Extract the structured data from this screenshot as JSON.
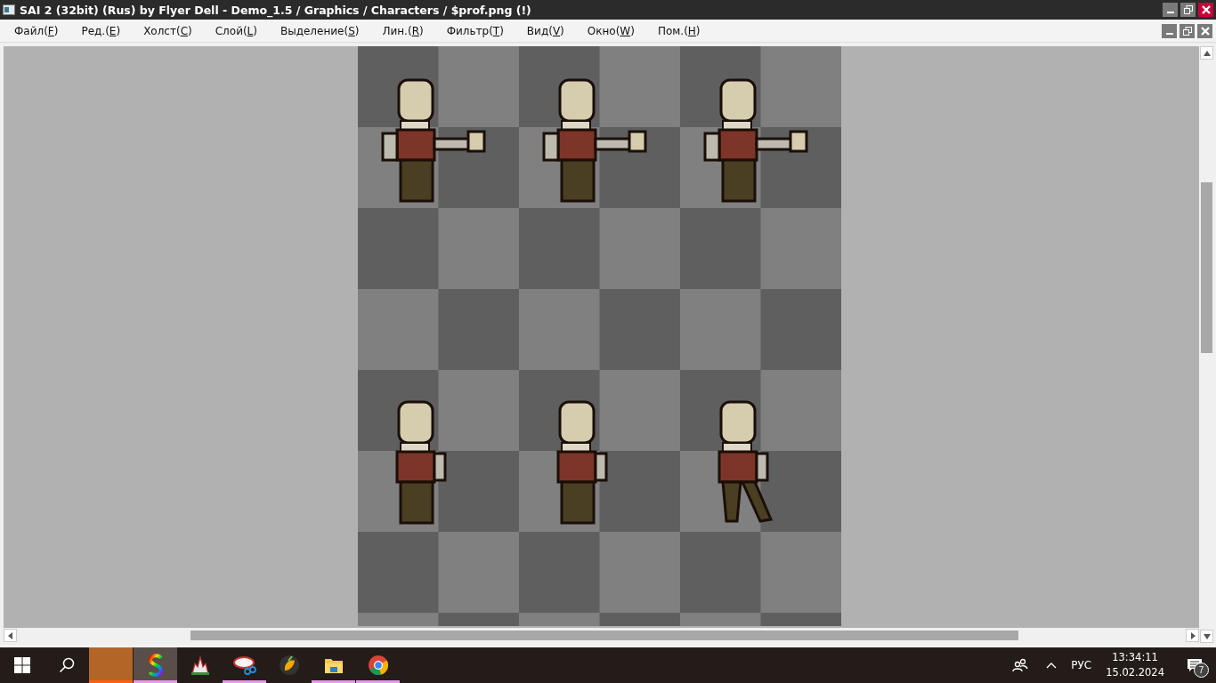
{
  "window": {
    "title": "SAI 2 (32bit) (Rus) by Flyer Dell - Demo_1.5 / Graphics / Characters / $prof.png (!)"
  },
  "menu": [
    {
      "before": "Файл(",
      "key": "F",
      "after": ")"
    },
    {
      "before": "Ред.(",
      "key": "E",
      "after": ")"
    },
    {
      "before": "Холст(",
      "key": "C",
      "after": ")"
    },
    {
      "before": "Слой(",
      "key": "L",
      "after": ")"
    },
    {
      "before": "Выделение(",
      "key": "S",
      "after": ")"
    },
    {
      "before": "Лин.(",
      "key": "R",
      "after": ")"
    },
    {
      "before": "Фильтр(",
      "key": "T",
      "after": ")"
    },
    {
      "before": "Вид(",
      "key": "V",
      "after": ")"
    },
    {
      "before": "Окно(",
      "key": "W",
      "after": ")"
    },
    {
      "before": "Пом.(",
      "key": "H",
      "after": ")"
    }
  ],
  "sprites": [
    {
      "kind": "reach"
    },
    {
      "kind": "reach"
    },
    {
      "kind": "reach"
    },
    {
      "kind": "stand"
    },
    {
      "kind": "stand"
    },
    {
      "kind": "walk"
    }
  ],
  "taskbar": {
    "apps": [
      {
        "kind": "block",
        "running": true,
        "selected": false,
        "color": "#f7630c"
      },
      {
        "kind": "s-logo",
        "running": true,
        "selected": true,
        "color": "#e49be6"
      },
      {
        "kind": "castle",
        "running": false,
        "selected": false
      },
      {
        "kind": "scissors",
        "running": true,
        "selected": false,
        "color": "#e49be6"
      },
      {
        "kind": "fruit",
        "running": false,
        "selected": false
      },
      {
        "kind": "folder",
        "running": true,
        "selected": false,
        "color": "#e49be6"
      },
      {
        "kind": "chrome",
        "running": true,
        "selected": false,
        "color": "#e49be6"
      }
    ],
    "language": "РУС",
    "time": "13:34:11",
    "date": "15.02.2024",
    "notifications": "7"
  }
}
